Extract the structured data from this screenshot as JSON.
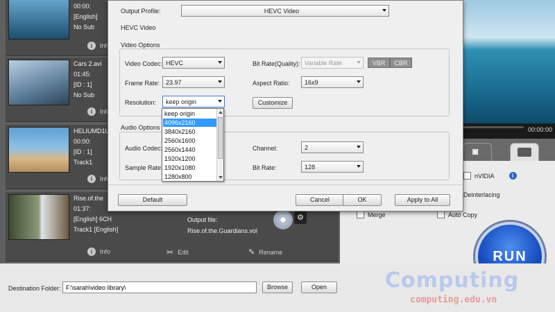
{
  "files": [
    {
      "name": "",
      "duration": "00:00:",
      "subtitle_lang": "[English]",
      "subtitle": "No Sub",
      "colors": [
        "#4a8fb8",
        "#1c4f6e"
      ],
      "info_label": "Info"
    },
    {
      "name": "Cars 2.avi",
      "duration": "01:45:",
      "id": "[ID : 1]",
      "subtitle": "No Sub",
      "colors": [
        "#9bb7cf",
        "#4d6e8a"
      ],
      "info_label": "Info"
    },
    {
      "name": "HELIUMD1U",
      "duration": "00:00:",
      "id": "[ID : 1]",
      "track": "Track1",
      "colors": [
        "#7fb2dd",
        "#c49f6c"
      ],
      "info_label": "Info"
    },
    {
      "name": "Rise.of.the",
      "duration": "01:37:",
      "audio": "[English] 6CH",
      "track": "Track1 [English]",
      "output_label": "Output file:",
      "output_file": "Rise.of.the.Guardians.vol",
      "colors": [
        "#56694a",
        "#8a7a5a"
      ],
      "info_label": "Info",
      "edit_label": "Edit",
      "rename_label": "Rename"
    }
  ],
  "preview": {
    "time": "00:00:00"
  },
  "options": {
    "nvidia_label": "nVIDIA",
    "deinterlacing_label": "Deinterlacing",
    "merge_label": "Merge",
    "autocopy_label": "Auto Copy"
  },
  "run_label": "RUN",
  "destination": {
    "label": "Destination Folder:",
    "path": "F:\\sarah\\video library\\",
    "browse_label": "Browse",
    "open_label": "Open"
  },
  "watermark": {
    "big": "Computing",
    "small": "computing.edu.vn"
  },
  "dialog": {
    "output_profile_label": "Output Profile:",
    "output_profile_value": "HEVC Video",
    "profile_heading": "HEVC Video",
    "video_options_label": "Video Options",
    "video_codec_label": "Video Codec:",
    "video_codec_value": "HEVC",
    "frame_rate_label": "Frame Rate:",
    "frame_rate_value": "23.97",
    "resolution_label": "Resolution:",
    "resolution_value": "keep origin",
    "bitrate_label": "Bit Rate(Quality):",
    "bitrate_value": "Variable Rate",
    "vbr_label": "VBR",
    "cbr_label": "CBR",
    "aspect_ratio_label": "Aspect Ratio:",
    "aspect_ratio_value": "16x9",
    "customize_label": "Customize",
    "audio_options_label": "Audio Options",
    "audio_codec_label": "Audio Codec:",
    "sample_rate_label": "Sample Rate:",
    "channel_label": "Channel:",
    "channel_value": "2",
    "audio_bitrate_label": "Bit Rate:",
    "audio_bitrate_value": "128",
    "default_label": "Default",
    "cancel_label": "Cancel",
    "ok_label": "OK",
    "apply_all_label": "Apply to All",
    "resolution_options": [
      "keep origin",
      "4096x2160",
      "3840x2160",
      "2560x1600",
      "2560x1440",
      "1920x1200",
      "1920x1080",
      "1280x800"
    ],
    "resolution_highlight_index": 1
  },
  "colors": {
    "accent": "#3399ff",
    "run": "#1a4fc2"
  }
}
